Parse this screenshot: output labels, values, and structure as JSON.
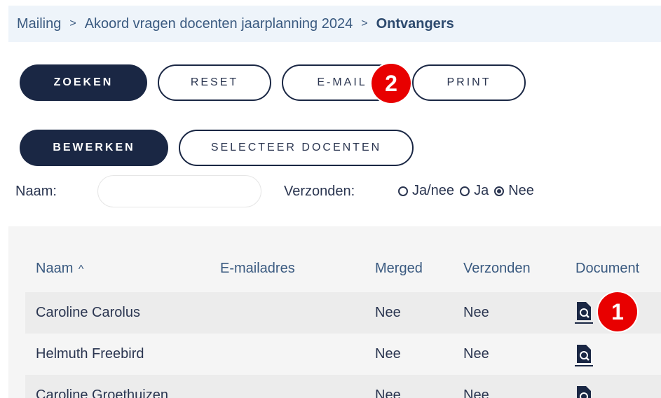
{
  "breadcrumb": {
    "items": [
      "Mailing",
      "Akoord vragen docenten jaarplanning 2024"
    ],
    "current": "Ontvangers",
    "separator": ">"
  },
  "toolbar": {
    "zoeken": "ZOEKEN",
    "reset": "RESET",
    "email": "E-MAIL",
    "print": "PRINT",
    "bewerken": "BEWERKEN",
    "selecteer": "SELECTEER DOCENTEN"
  },
  "markers": {
    "one": "1",
    "two": "2"
  },
  "filters": {
    "naam_label": "Naam:",
    "naam_value": "",
    "verzonden_label": "Verzonden:",
    "options": [
      "Ja/nee",
      "Ja",
      "Nee"
    ],
    "selected": "Nee"
  },
  "table": {
    "headers": {
      "naam": "Naam",
      "sort_indicator": "^",
      "email": "E-mailadres",
      "merged": "Merged",
      "verzonden": "Verzonden",
      "document": "Document"
    },
    "rows": [
      {
        "naam": "Caroline Carolus",
        "email": "",
        "merged": "Nee",
        "verzonden": "Nee",
        "document_icon": "document-search-icon"
      },
      {
        "naam": "Helmuth Freebird",
        "email": "",
        "merged": "Nee",
        "verzonden": "Nee",
        "document_icon": "document-search-icon"
      },
      {
        "naam": "Caroline Groethuizen",
        "email": "",
        "merged": "Nee",
        "verzonden": "Nee",
        "document_icon": "document-search-icon"
      }
    ]
  },
  "colors": {
    "primary_dark": "#1a2744",
    "breadcrumb_bg": "#eef4fa",
    "marker_red": "#e80000",
    "header_text": "#3a5a80"
  }
}
